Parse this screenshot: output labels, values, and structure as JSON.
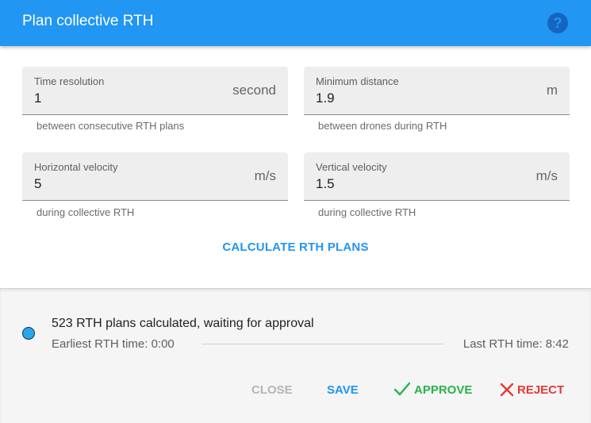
{
  "header": {
    "title": "Plan collective RTH",
    "help_icon": "?"
  },
  "fields": {
    "time_resolution": {
      "label": "Time resolution",
      "value": "1",
      "unit": "second",
      "helper": "between consecutive RTH plans"
    },
    "minimum_distance": {
      "label": "Minimum distance",
      "value": "1.9",
      "unit": "m",
      "helper": "between drones during RTH"
    },
    "horizontal_velocity": {
      "label": "Horizontal velocity",
      "value": "5",
      "unit": "m/s",
      "helper": "during collective RTH"
    },
    "vertical_velocity": {
      "label": "Vertical velocity",
      "value": "1.5",
      "unit": "m/s",
      "helper": "during collective RTH"
    }
  },
  "calculate_button": "CALCULATE RTH PLANS",
  "status": {
    "message": "523 RTH plans calculated, waiting for approval",
    "earliest": "Earliest RTH time: 0:00",
    "last": "Last RTH time: 8:42",
    "dot_color": "#29a8e8"
  },
  "actions": {
    "close": "CLOSE",
    "save": "SAVE",
    "approve": "APPROVE",
    "reject": "REJECT"
  },
  "colors": {
    "primary": "#2196f3",
    "approve": "#27b34a",
    "reject": "#e53935",
    "disabled": "#b5b5b5"
  }
}
